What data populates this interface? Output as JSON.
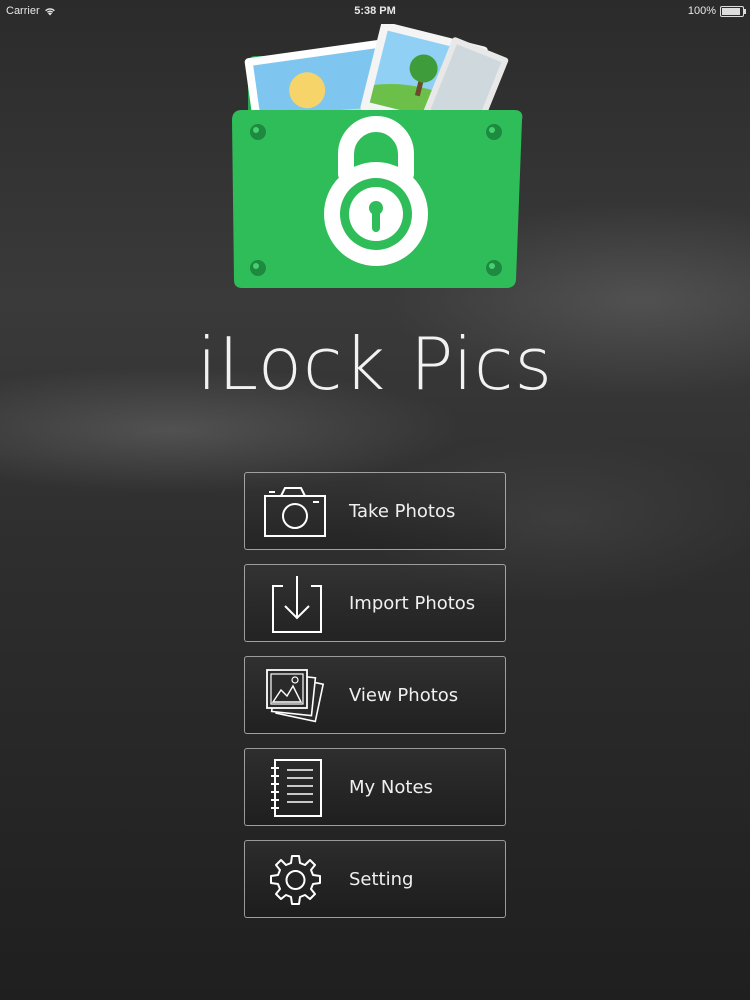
{
  "status_bar": {
    "carrier": "Carrier",
    "time": "5:38 PM",
    "battery": "100%",
    "battery_level": 1.0
  },
  "app": {
    "title": "iLock Pics",
    "logo_icon": "locked-photo-folder-icon",
    "accent_color": "#2ebd5a"
  },
  "menu": [
    {
      "label": "Take Photos",
      "icon": "camera-icon"
    },
    {
      "label": "Import Photos",
      "icon": "import-icon"
    },
    {
      "label": "View Photos",
      "icon": "photos-stack-icon"
    },
    {
      "label": "My Notes",
      "icon": "notebook-icon"
    },
    {
      "label": "Setting",
      "icon": "gear-icon"
    }
  ]
}
